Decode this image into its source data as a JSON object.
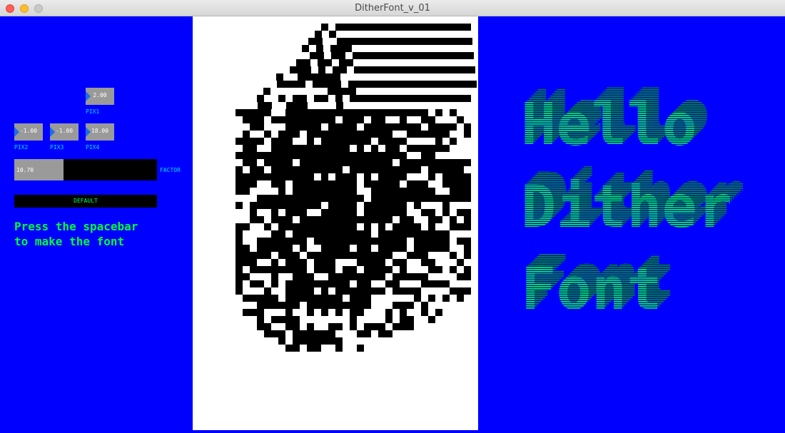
{
  "window": {
    "title": "DitherFont_v_01"
  },
  "controls": {
    "pix1": {
      "value": "2.00",
      "label": "PIX1"
    },
    "pix2": {
      "value": "-1.00",
      "label": "PIX2"
    },
    "pix3": {
      "value": "-1.00",
      "label": "PIX3"
    },
    "pix4": {
      "value": "18.00",
      "label": "PIX4"
    },
    "factor": {
      "value": "10.70",
      "label": "FACTOR",
      "fill_fraction": 0.345
    },
    "default_button": "DEFAULT"
  },
  "instructions": [
    "Press the spacebar",
    "to make the font"
  ],
  "preview": {
    "lines": [
      "Hello",
      "Dither",
      "Font"
    ],
    "colors": {
      "front": "#00ff22",
      "shadow": "#008c10",
      "background": "#0000ff"
    }
  },
  "colors": {
    "panel": "#0000ff",
    "canvas": "#ffffff",
    "ink": "#000000",
    "accent_label": "#00e0ff",
    "text_green": "#00ff33"
  }
}
